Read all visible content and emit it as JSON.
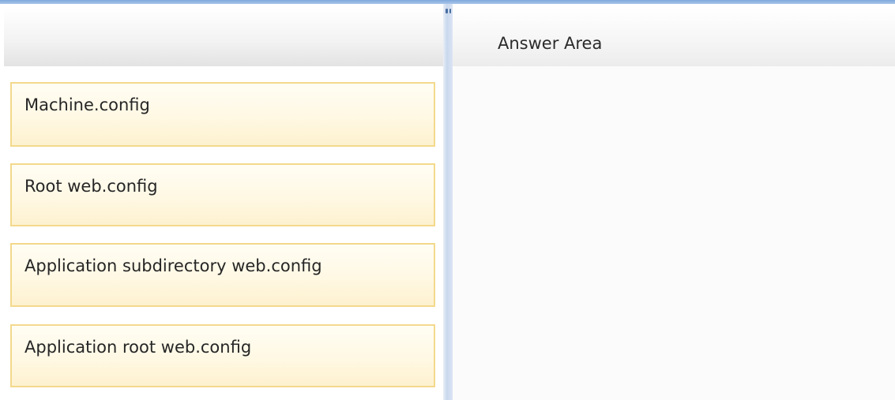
{
  "answer_area": {
    "title": "Answer Area"
  },
  "choices": [
    {
      "label": "Machine.config"
    },
    {
      "label": "Root web.config"
    },
    {
      "label": "Application subdirectory web.config"
    },
    {
      "label": "Application root web.config"
    }
  ],
  "icons": {
    "splitter_grip": "drag-handle-icon"
  },
  "colors": {
    "choice_border": "#f3d98c",
    "choice_fill": "#fff8e3",
    "top_border": "#7fa9dd",
    "splitter": "#c9d8ee"
  }
}
